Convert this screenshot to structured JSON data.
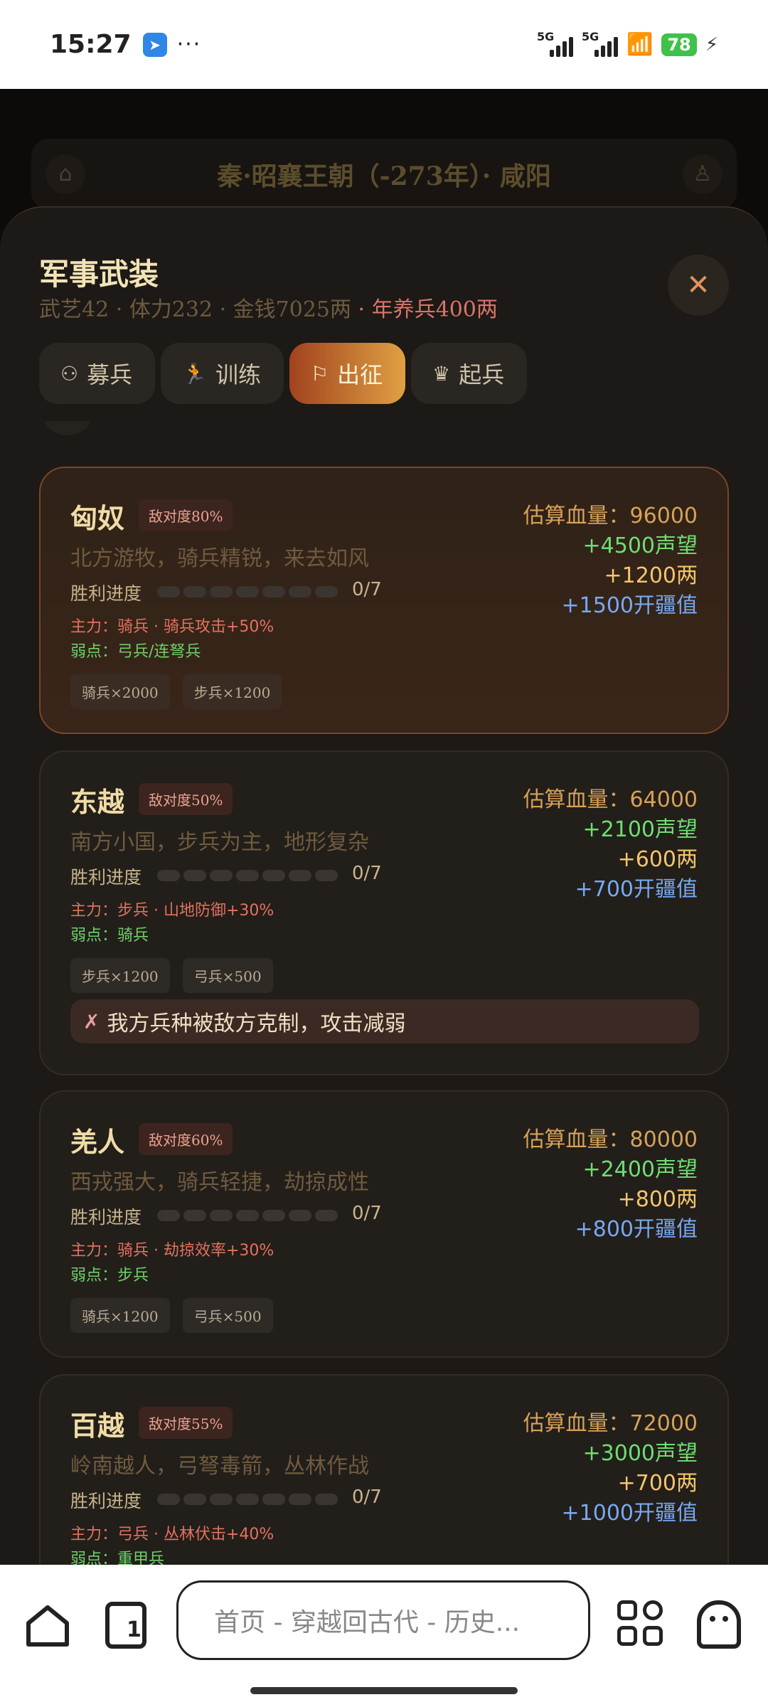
{
  "status_bar": {
    "time": "15:27",
    "more": "···",
    "signal1": "5G",
    "signal2": "5G",
    "battery": "78"
  },
  "background": {
    "title": "秦·昭襄王朝（-273年）· 咸阳"
  },
  "modal": {
    "title": "军事武装",
    "stats": "武艺42 · 体力232 · 金钱7025两",
    "upkeep": "· 年养兵400两",
    "close": "✕",
    "tabs": [
      {
        "label": "募兵",
        "icon": "people-icon"
      },
      {
        "label": "训练",
        "icon": "runner-icon"
      },
      {
        "label": "出征",
        "icon": "flag-icon"
      },
      {
        "label": "起兵",
        "icon": "crown-icon"
      }
    ]
  },
  "cards": [
    {
      "name": "匈奴",
      "hostility": "敌对度80%",
      "desc": "北方游牧，骑兵精锐，来去如风",
      "progress_label": "胜利进度",
      "progress": "0/7",
      "main": "主力：骑兵 · 骑兵攻击+50%",
      "weak": "弱点：弓兵/连弩兵",
      "tags": [
        "骑兵×2000",
        "步兵×1200"
      ],
      "hp": "估算血量：96000",
      "reputation": "+4500声望",
      "gold": "+1200两",
      "territory": "+1500开疆值"
    },
    {
      "name": "东越",
      "hostility": "敌对度50%",
      "desc": "南方小国，步兵为主，地形复杂",
      "progress_label": "胜利进度",
      "progress": "0/7",
      "main": "主力：步兵 · 山地防御+30%",
      "weak": "弱点：骑兵",
      "tags": [
        "步兵×1200",
        "弓兵×500"
      ],
      "hp": "估算血量：64000",
      "reputation": "+2100声望",
      "gold": "+600两",
      "territory": "+700开疆值",
      "warning": "我方兵种被敌方克制，攻击减弱"
    },
    {
      "name": "羌人",
      "hostility": "敌对度60%",
      "desc": "西戎强大，骑兵轻捷，劫掠成性",
      "progress_label": "胜利进度",
      "progress": "0/7",
      "main": "主力：骑兵 · 劫掠效率+30%",
      "weak": "弱点：步兵",
      "tags": [
        "骑兵×1200",
        "弓兵×500"
      ],
      "hp": "估算血量：80000",
      "reputation": "+2400声望",
      "gold": "+800两",
      "territory": "+800开疆值"
    },
    {
      "name": "百越",
      "hostility": "敌对度55%",
      "desc": "岭南越人，弓弩毒箭，丛林作战",
      "progress_label": "胜利进度",
      "progress": "0/7",
      "main": "主力：弓兵 · 丛林伏击+40%",
      "weak": "弱点：重甲兵",
      "tags": [],
      "hp": "估算血量：72000",
      "reputation": "+3000声望",
      "gold": "+700两",
      "territory": "+1000开疆值"
    }
  ],
  "browser": {
    "url": "首页 - 穿越回古代 - 历史...",
    "tab_count": "1"
  }
}
